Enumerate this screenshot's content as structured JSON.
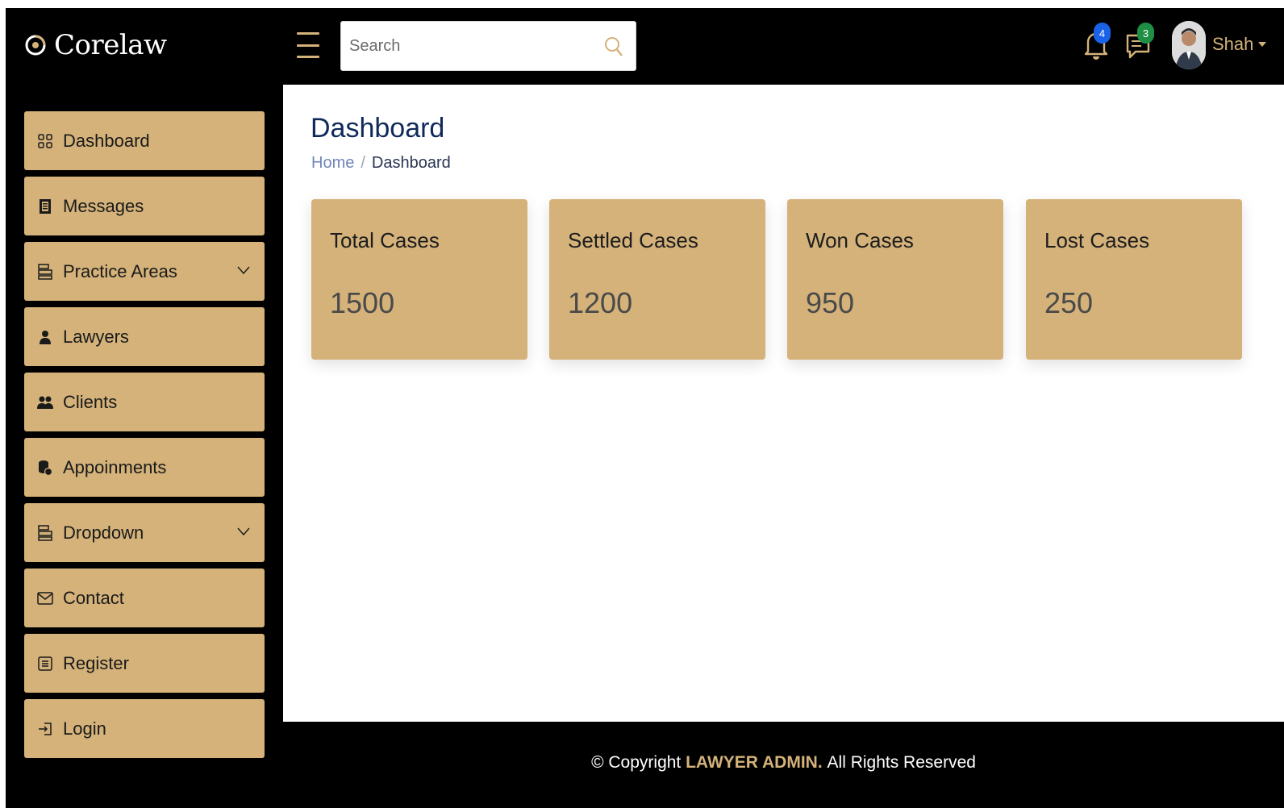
{
  "brand": {
    "name": "Corelaw"
  },
  "header": {
    "search_placeholder": "Search",
    "notifications_count": "4",
    "messages_count": "3",
    "user_name": "Shah",
    "accent_color": "#d4b27a"
  },
  "sidebar": {
    "items": [
      {
        "label": "Dashboard",
        "icon": "grid-icon"
      },
      {
        "label": "Messages",
        "icon": "receipt-icon"
      },
      {
        "label": "Practice Areas",
        "icon": "layers-icon",
        "expandable": true
      },
      {
        "label": "Lawyers",
        "icon": "person-icon"
      },
      {
        "label": "Clients",
        "icon": "people-icon"
      },
      {
        "label": "Appoinments",
        "icon": "coins-icon"
      },
      {
        "label": "Dropdown",
        "icon": "layers-icon",
        "expandable": true
      },
      {
        "label": "Contact",
        "icon": "envelope-icon"
      },
      {
        "label": "Register",
        "icon": "list-icon"
      },
      {
        "label": "Login",
        "icon": "login-icon"
      }
    ]
  },
  "main": {
    "title": "Dashboard",
    "breadcrumb": {
      "home": "Home",
      "separator": "/",
      "current": "Dashboard"
    },
    "cards": [
      {
        "title": "Total Cases",
        "value": "1500"
      },
      {
        "title": "Settled Cases",
        "value": "1200"
      },
      {
        "title": "Won Cases",
        "value": "950"
      },
      {
        "title": "Lost Cases",
        "value": "250"
      }
    ]
  },
  "footer": {
    "prefix": "© Copyright",
    "brand": "LAWYER ADMIN.",
    "suffix": "All Rights Reserved"
  }
}
